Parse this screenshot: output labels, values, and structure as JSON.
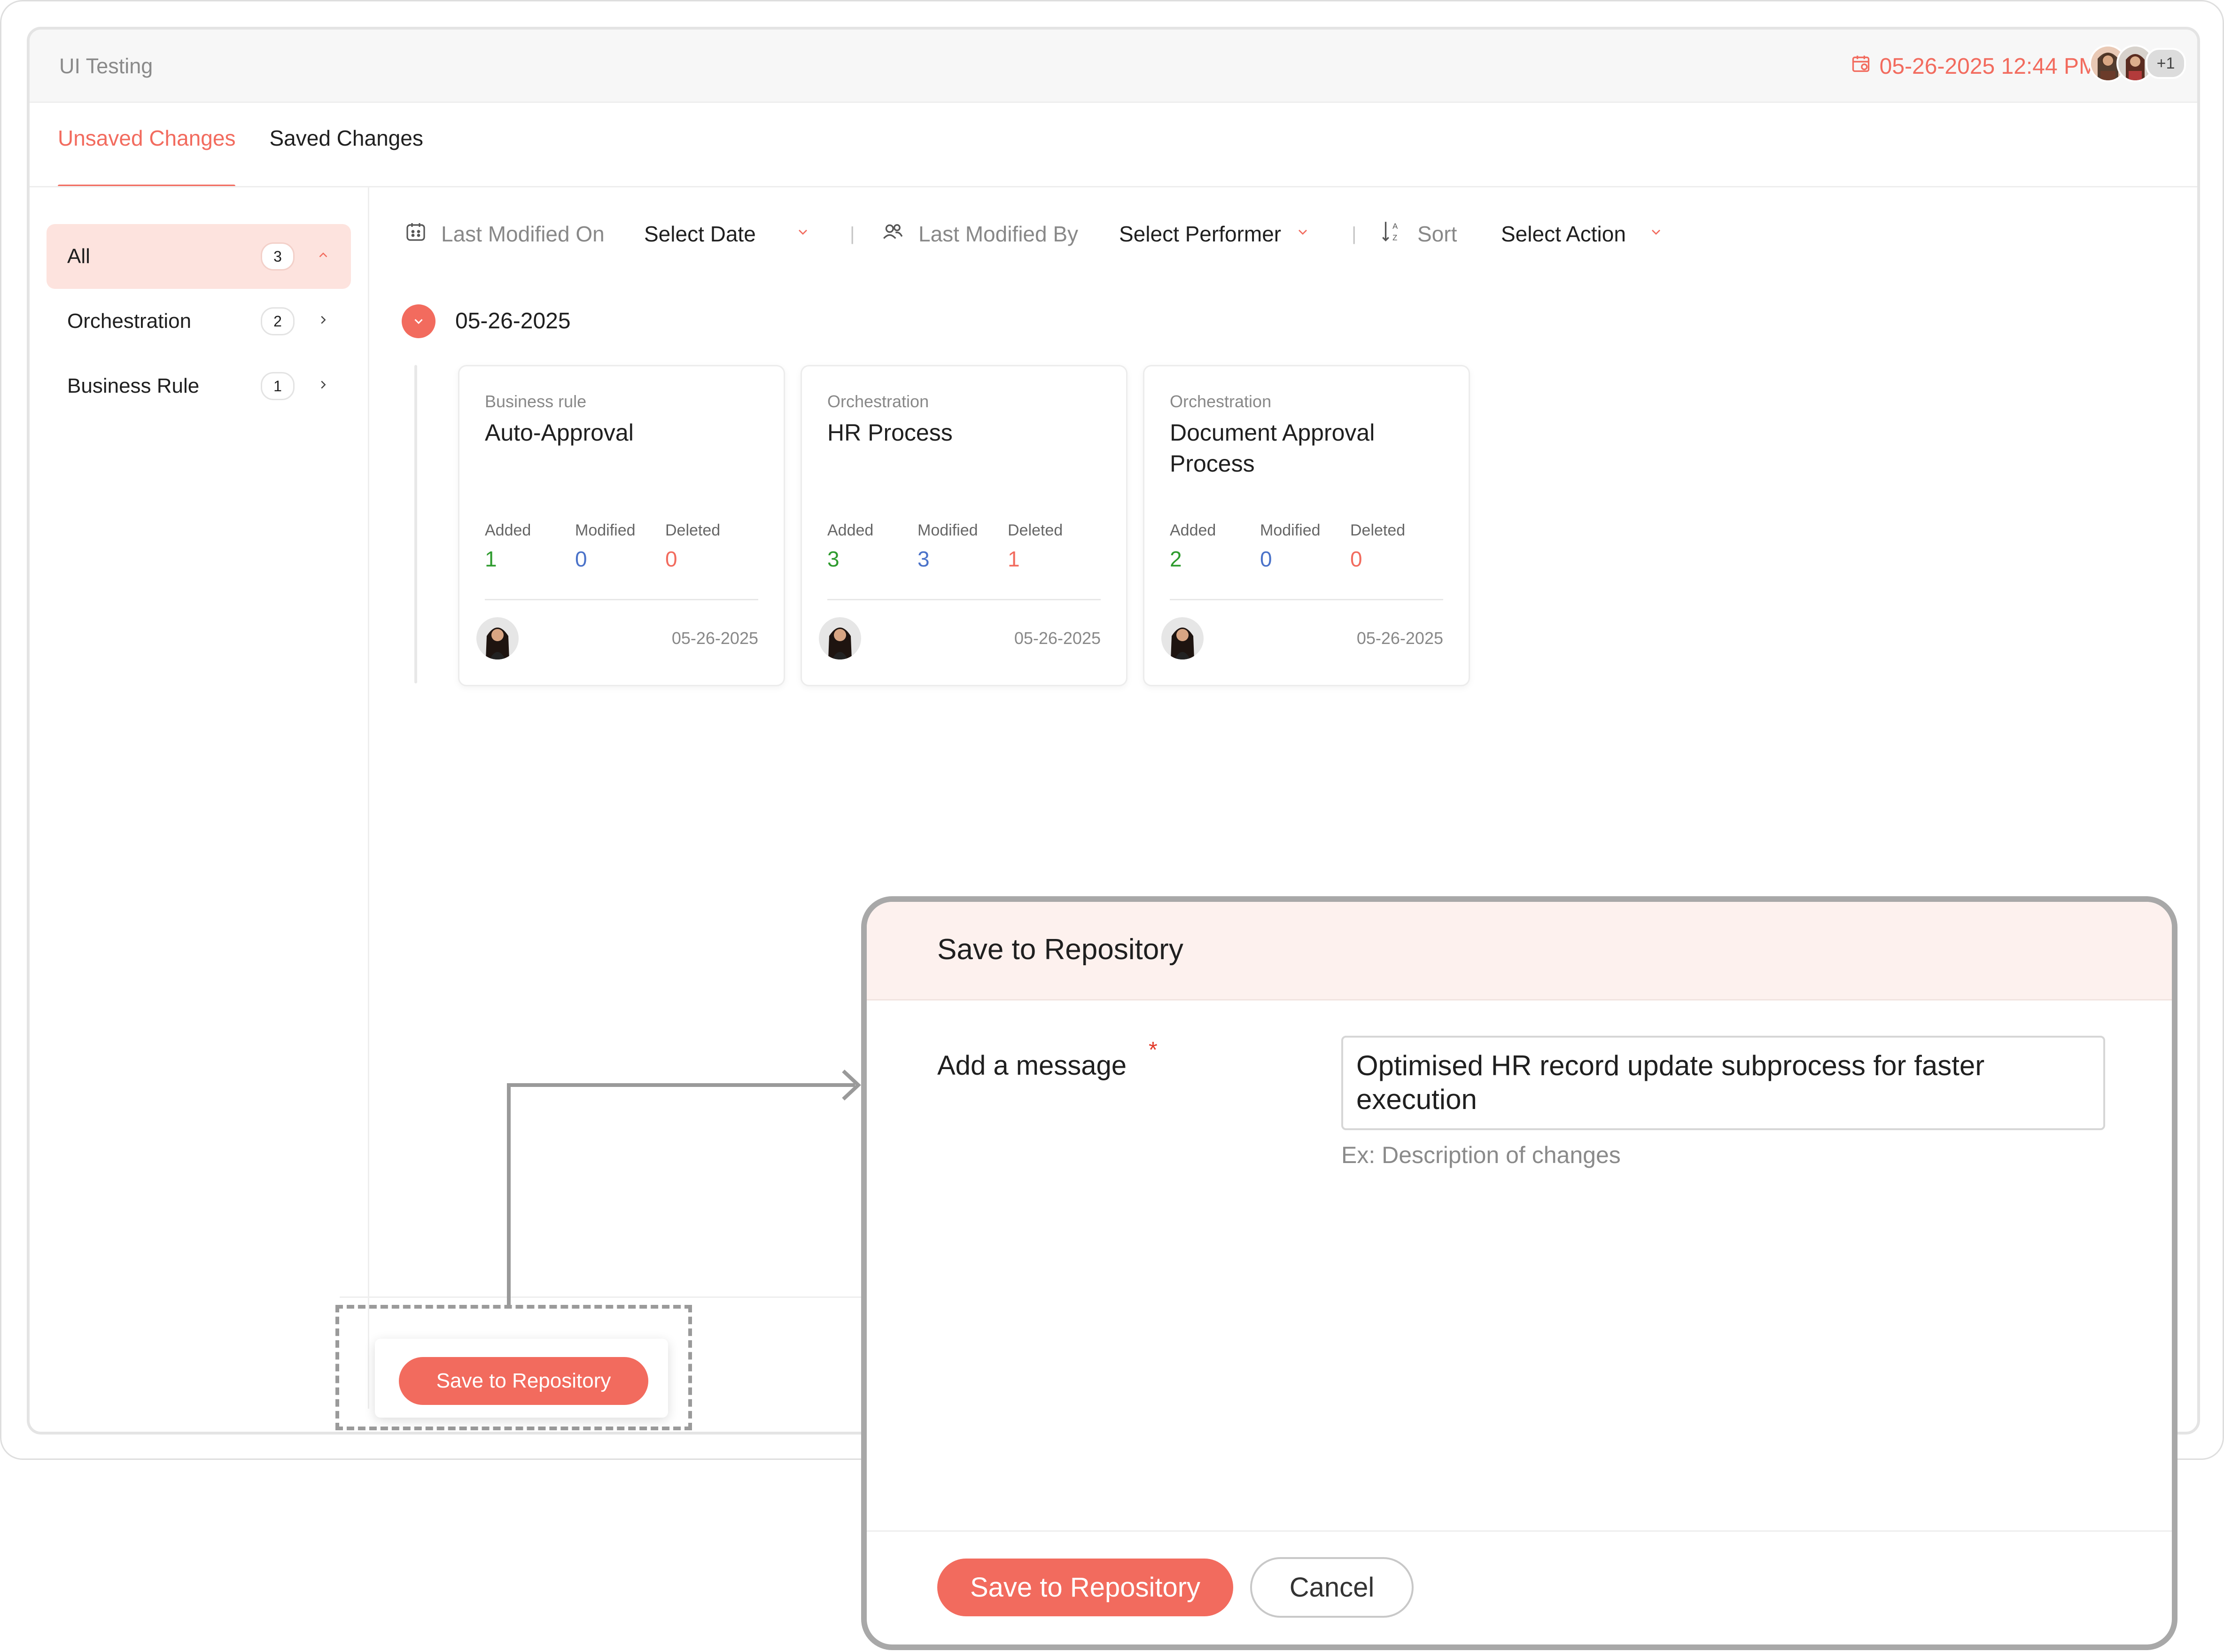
{
  "app": {
    "title": "UI Testing",
    "timestamp": "05-26-2025 12:44 PM",
    "extra_users": "+1"
  },
  "tabs": [
    {
      "label": "Unsaved Changes",
      "active": true
    },
    {
      "label": "Saved Changes",
      "active": false
    }
  ],
  "sidebar": {
    "items": [
      {
        "label": "All",
        "count": "3",
        "active": true
      },
      {
        "label": "Orchestration",
        "count": "2",
        "active": false
      },
      {
        "label": "Business Rule",
        "count": "1",
        "active": false
      }
    ]
  },
  "filters": {
    "last_modified_on_label": "Last Modified On",
    "date_value": "Select Date",
    "last_modified_by_label": "Last Modified By",
    "performer_value": "Select Performer",
    "sort_label": "Sort",
    "action_value": "Select Action",
    "separator": "|"
  },
  "group": {
    "date": "05-26-2025"
  },
  "cards": [
    {
      "type": "Business rule",
      "title": "Auto-Approval",
      "added_label": "Added",
      "added": "1",
      "modified_label": "Modified",
      "modified": "0",
      "deleted_label": "Deleted",
      "deleted": "0",
      "date": "05-26-2025"
    },
    {
      "type": "Orchestration",
      "title": "HR Process",
      "added_label": "Added",
      "added": "3",
      "modified_label": "Modified",
      "modified": "3",
      "deleted_label": "Deleted",
      "deleted": "1",
      "date": "05-26-2025"
    },
    {
      "type": "Orchestration",
      "title": "Document Approval Process",
      "added_label": "Added",
      "added": "2",
      "modified_label": "Modified",
      "modified": "0",
      "deleted_label": "Deleted",
      "deleted": "0",
      "date": "05-26-2025"
    }
  ],
  "footer": {
    "save_label": "Save to Repository"
  },
  "modal": {
    "title": "Save to Repository",
    "message_label": "Add a message",
    "required_mark": "*",
    "message_value": "Optimised HR record update subprocess for faster execution",
    "hint": "Ex: Description of changes",
    "save_label": "Save to Repository",
    "cancel_label": "Cancel"
  },
  "colors": {
    "accent": "#f26b5e",
    "added": "#2e9b2e",
    "modified": "#4a72c9",
    "deleted": "#f26b5e"
  },
  "icons": [
    "calendar-icon",
    "users-icon",
    "sort-az-icon",
    "chevron-down-icon",
    "chevron-up-icon",
    "chevron-right-icon"
  ]
}
